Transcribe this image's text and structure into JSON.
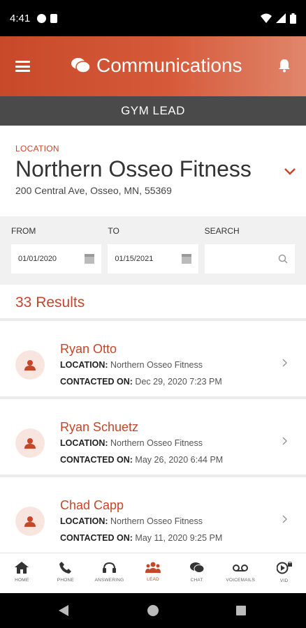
{
  "status_bar": {
    "time": "4:41"
  },
  "header": {
    "title": "Communications",
    "icons": [
      "menu-icon",
      "chat-bubbles-icon",
      "bell-icon"
    ]
  },
  "subheader": {
    "title": "GYM LEAD"
  },
  "location": {
    "label": "LOCATION",
    "name": "Northern Osseo Fitness",
    "address": "200 Central Ave, Osseo, MN, 55369"
  },
  "filters": {
    "from_label": "FROM",
    "from_value": "01/01/2020",
    "to_label": "TO",
    "to_value": "01/15/2021",
    "search_label": "SEARCH",
    "search_value": ""
  },
  "results": {
    "count_text": "33 Results"
  },
  "leads": [
    {
      "name": "Ryan Otto",
      "location_label": "LOCATION:",
      "location": "Northern Osseo Fitness",
      "contacted_label": "CONTACTED ON:",
      "contacted": "Dec 29, 2020 7:23 PM"
    },
    {
      "name": "Ryan Schuetz",
      "location_label": "LOCATION:",
      "location": "Northern Osseo Fitness",
      "contacted_label": "CONTACTED ON:",
      "contacted": "May 26, 2020 6:44 PM"
    },
    {
      "name": "Chad Capp",
      "location_label": "LOCATION:",
      "location": "Northern Osseo Fitness",
      "contacted_label": "CONTACTED ON:",
      "contacted": "May 11, 2020 9:25 PM"
    }
  ],
  "bottom_nav": [
    {
      "label": "HOME",
      "icon": "home-icon"
    },
    {
      "label": "PHONE",
      "icon": "phone-icon"
    },
    {
      "label": "ANSWERING",
      "icon": "headset-icon"
    },
    {
      "label": "LEAD",
      "icon": "group-icon",
      "active": true
    },
    {
      "label": "CHAT",
      "icon": "chat-icon"
    },
    {
      "label": "VOICEMAILS",
      "icon": "voicemail-icon"
    },
    {
      "label": "VID",
      "icon": "play-icon"
    }
  ],
  "colors": {
    "accent": "#c4472b",
    "header": "#d65a3a",
    "subheader": "#4a4a4a"
  }
}
